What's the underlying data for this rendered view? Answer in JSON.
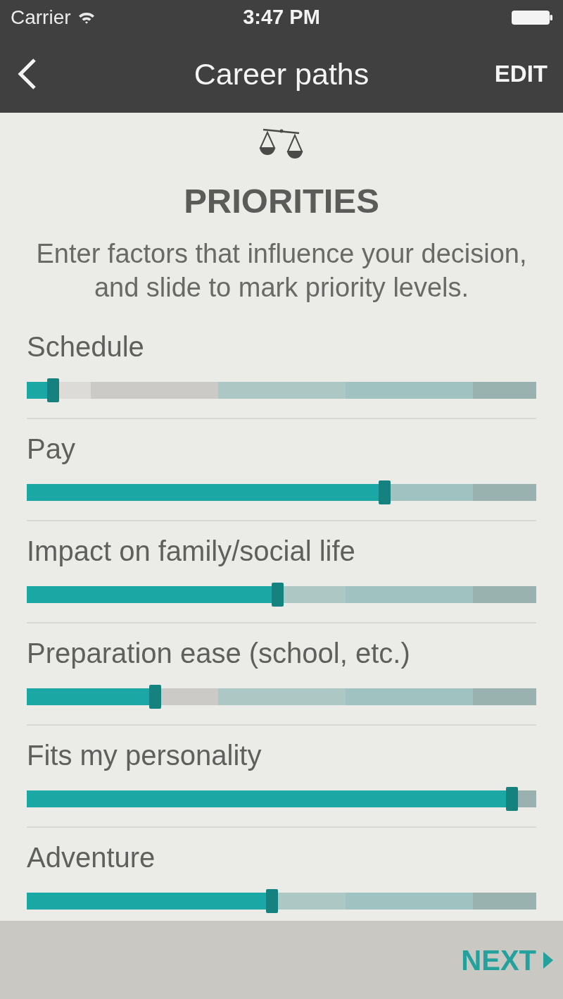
{
  "status_bar": {
    "carrier": "Carrier",
    "time": "3:47 PM"
  },
  "nav_bar": {
    "title": "Career paths",
    "action": "EDIT"
  },
  "header": {
    "title": "PRIORITIES",
    "description": "Enter factors that influence your decision, and slide to mark priority levels."
  },
  "priorities": [
    {
      "label": "Schedule",
      "level": 0.04
    },
    {
      "label": "Pay",
      "level": 0.69
    },
    {
      "label": "Impact on family/social life",
      "level": 0.48
    },
    {
      "label": "Preparation ease (school, etc.)",
      "level": 0.24
    },
    {
      "label": "Fits my personality",
      "level": 0.94
    },
    {
      "label": "Adventure",
      "level": 0.47
    }
  ],
  "footer": {
    "next": "NEXT"
  }
}
